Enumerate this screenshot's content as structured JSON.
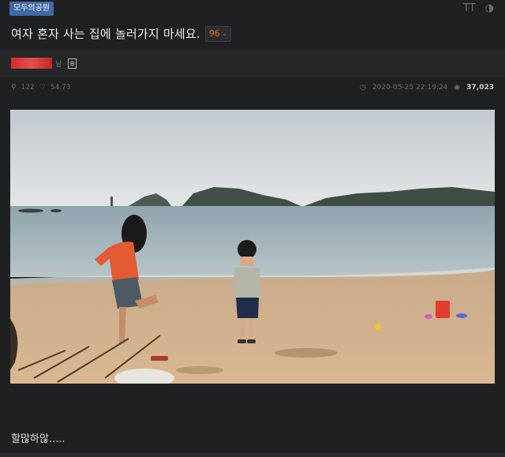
{
  "board": {
    "tag": "모두의공원"
  },
  "top_icons": {
    "font_size": "TT",
    "theme": "◑"
  },
  "post": {
    "title": "여자 혼자 사는 집에 놀러가지 마세요.",
    "reply_count": "96",
    "author_suffix": "님",
    "likes": "122",
    "hearts": "54.73",
    "datetime": "2020-05-25 22:19:24",
    "views": "37,023",
    "caption": "할많하않....."
  },
  "icons": {
    "board-tag": "label",
    "font-size": "text-size-icon",
    "theme": "contrast-icon",
    "doc": "document-icon",
    "pin": "pin-icon",
    "heart": "heart-icon",
    "clock": "clock-icon",
    "eye": "eye-icon"
  },
  "colors": {
    "background": "#1f2022",
    "author_bar": "#262729",
    "tag": "#3e6aa8",
    "reply": "#e0632a",
    "nick": "#d92b2b"
  }
}
